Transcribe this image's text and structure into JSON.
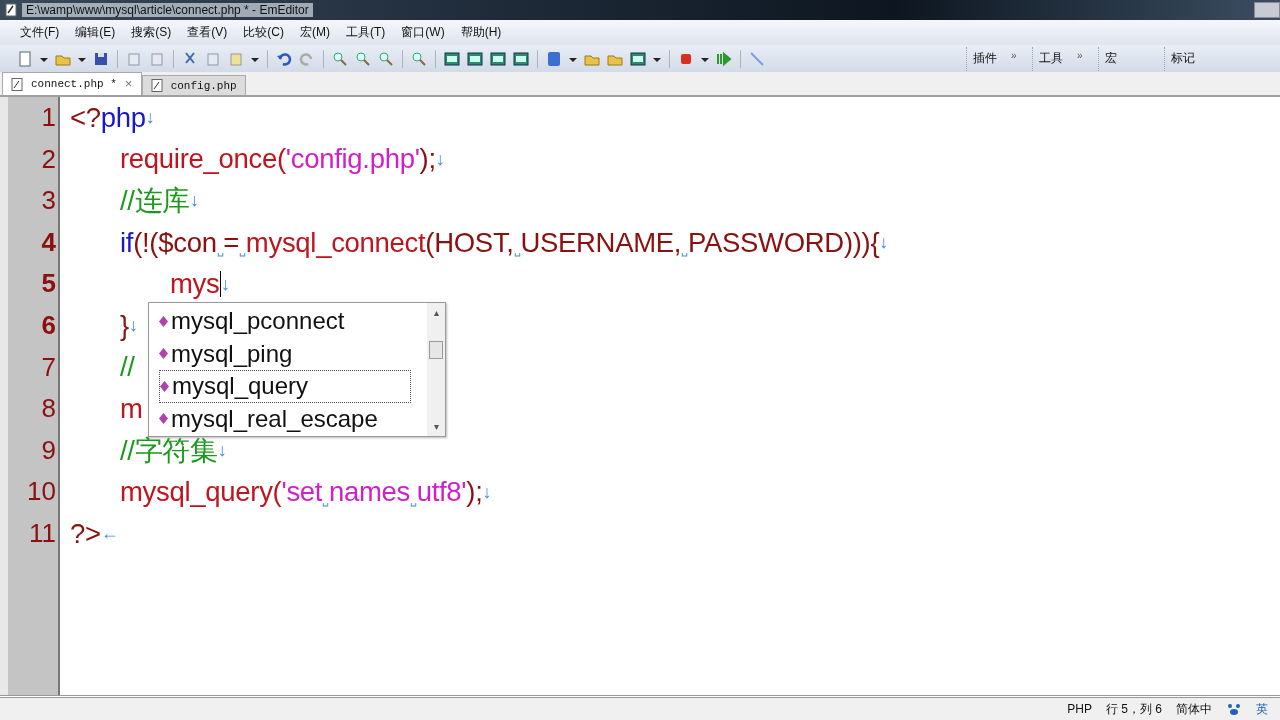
{
  "window": {
    "title": "E:\\wamp\\www\\mysql\\article\\connect.php * - EmEditor"
  },
  "menu": [
    "文件(F)",
    "编辑(E)",
    "搜索(S)",
    "查看(V)",
    "比较(C)",
    "宏(M)",
    "工具(T)",
    "窗口(W)",
    "帮助(H)"
  ],
  "toolbar_groups": [
    {
      "label": "插件",
      "more": "»"
    },
    {
      "label": "工具",
      "more": "»"
    },
    {
      "label": "宏"
    },
    {
      "label": "标记"
    }
  ],
  "tabs": [
    {
      "label": "connect.php *",
      "selected": true,
      "close": "×"
    },
    {
      "label": "config.php",
      "selected": false
    }
  ],
  "lines": [
    {
      "number": "1",
      "modified": false,
      "tokens": [
        {
          "kind": "plain",
          "text": "<?"
        },
        {
          "kind": "keyword",
          "text": "php"
        },
        {
          "kind": "eol",
          "text": "↓"
        }
      ]
    },
    {
      "number": "2",
      "modified": false,
      "tokens": [
        {
          "kind": "func",
          "text": "\trequire_once("
        },
        {
          "kind": "string",
          "text": "'config.php'"
        },
        {
          "kind": "plain",
          "text": ");"
        },
        {
          "kind": "eol",
          "text": "↓"
        }
      ]
    },
    {
      "number": "3",
      "modified": false,
      "tokens": [
        {
          "kind": "comment",
          "text": "\t//连库"
        },
        {
          "kind": "eol",
          "text": "↓"
        }
      ]
    },
    {
      "number": "4",
      "modified": true,
      "tokens": [
        {
          "kind": "keyword",
          "text": "\tif"
        },
        {
          "kind": "plain",
          "text": "(!($con"
        },
        {
          "kind": "space",
          "text": "␣"
        },
        {
          "kind": "plain",
          "text": "="
        },
        {
          "kind": "space",
          "text": "␣"
        },
        {
          "kind": "func",
          "text": "mysql_connect"
        },
        {
          "kind": "plain",
          "text": "(HOST,"
        },
        {
          "kind": "space",
          "text": "␣"
        },
        {
          "kind": "plain",
          "text": "USERNAME,"
        },
        {
          "kind": "space",
          "text": "␣"
        },
        {
          "kind": "plain",
          "text": "PASSWORD))){"
        },
        {
          "kind": "eol",
          "text": "↓"
        }
      ]
    },
    {
      "number": "5",
      "modified": true,
      "caret": true,
      "tokens": [
        {
          "kind": "func",
          "text": "\t\tmys"
        },
        {
          "kind": "eol",
          "text": "↓"
        }
      ]
    },
    {
      "number": "6",
      "modified": true,
      "tokens": [
        {
          "kind": "plain",
          "text": "\t}"
        },
        {
          "kind": "eol",
          "text": "↓"
        }
      ]
    },
    {
      "number": "7",
      "modified": false,
      "tokens": [
        {
          "kind": "comment",
          "text": "\t//"
        }
      ]
    },
    {
      "number": "8",
      "modified": false,
      "tokens": [
        {
          "kind": "func",
          "text": "\tm"
        }
      ]
    },
    {
      "number": "9",
      "modified": false,
      "tokens": [
        {
          "kind": "comment",
          "text": "\t//字符集"
        },
        {
          "kind": "eol",
          "text": "↓"
        }
      ]
    },
    {
      "number": "10",
      "modified": false,
      "tokens": [
        {
          "kind": "func",
          "text": "\tmysql_query("
        },
        {
          "kind": "string",
          "text": "'set"
        },
        {
          "kind": "space",
          "text": "␣"
        },
        {
          "kind": "string",
          "text": "names"
        },
        {
          "kind": "space",
          "text": "␣"
        },
        {
          "kind": "string",
          "text": "utf8'"
        },
        {
          "kind": "plain",
          "text": ");"
        },
        {
          "kind": "eol",
          "text": "↓"
        }
      ]
    },
    {
      "number": "11",
      "modified": false,
      "tokens": [
        {
          "kind": "plain",
          "text": "?>"
        },
        {
          "kind": "eof",
          "text": "←"
        }
      ]
    }
  ],
  "completion": {
    "items": [
      {
        "label": "mysql_pconnect",
        "selected": false
      },
      {
        "label": "mysql_ping",
        "selected": false
      },
      {
        "label": "mysql_query",
        "selected": true
      },
      {
        "label": "mysql_real_escape",
        "selected": false
      }
    ],
    "scroll_up": "▴",
    "scroll_down": "▾"
  },
  "status_bar": {
    "mode": "PHP",
    "position": "行 5，列 6",
    "ime": "简体中",
    "ime_lang": "英"
  }
}
